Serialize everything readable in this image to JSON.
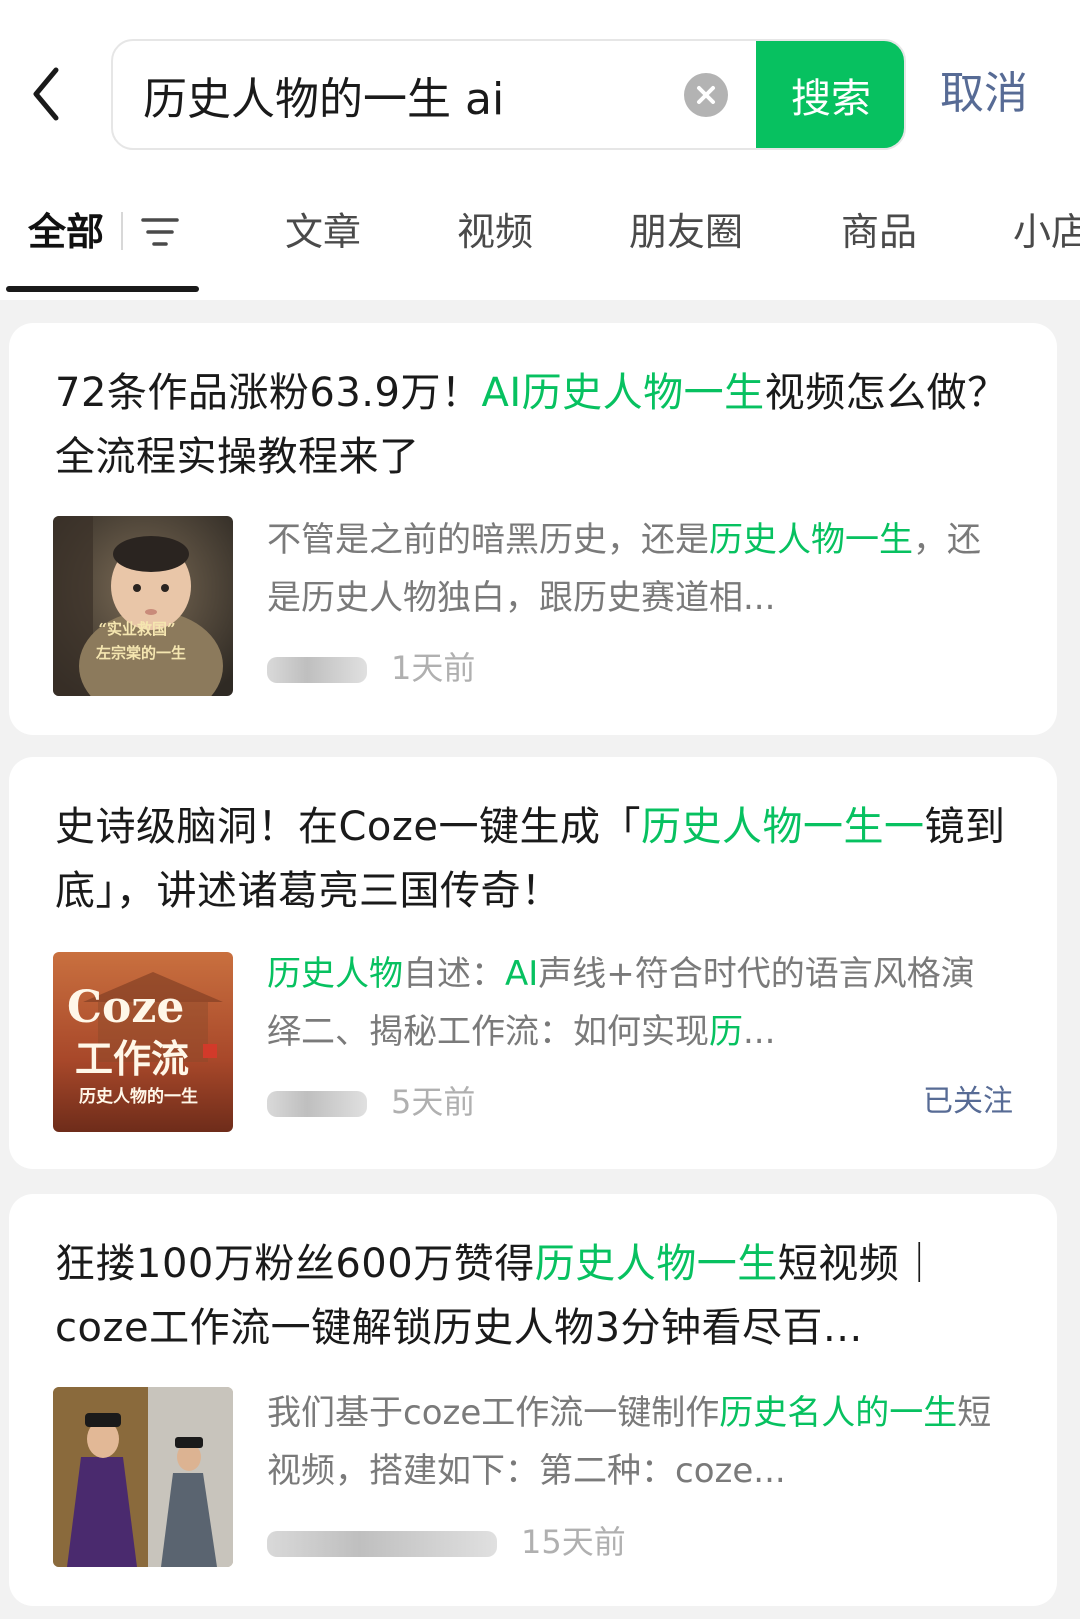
{
  "search": {
    "query": "历史人物的一生 ai",
    "search_button": "搜索",
    "cancel": "取消"
  },
  "tabs": [
    {
      "label": "全部"
    },
    {
      "label": "文章"
    },
    {
      "label": "视频"
    },
    {
      "label": "朋友圈"
    },
    {
      "label": "商品"
    },
    {
      "label": "小店"
    }
  ],
  "results": [
    {
      "title_parts": [
        {
          "text": "72条作品涨粉63.9万！",
          "hl": false
        },
        {
          "text": "AI历史人物一生",
          "hl": true
        },
        {
          "text": "视频怎么做？全流程实操教程来了",
          "hl": false
        }
      ],
      "desc_parts": [
        {
          "text": "不管是之前的暗黑历史，还是",
          "hl": false
        },
        {
          "text": "历史人物一生",
          "hl": true
        },
        {
          "text": "，还是历史人物独白，跟历史赛道相...",
          "hl": false
        }
      ],
      "thumb_caption_1": "“实业救国”",
      "thumb_caption_2": "左宗棠的一生",
      "time": "1天前",
      "followed": ""
    },
    {
      "title_parts": [
        {
          "text": "史诗级脑洞！在Coze一键生成「",
          "hl": false
        },
        {
          "text": "历史人物一生一",
          "hl": true
        },
        {
          "text": "镜到底」，讲述诸葛亮三国传奇！",
          "hl": false
        }
      ],
      "desc_parts": [
        {
          "text": "历史人物",
          "hl": true
        },
        {
          "text": "自述：",
          "hl": false
        },
        {
          "text": "AI",
          "hl": true
        },
        {
          "text": "声线+符合时代的语言风格演绎二、揭秘工作流：如何实现",
          "hl": false
        },
        {
          "text": "历",
          "hl": true
        },
        {
          "text": "...",
          "hl": false
        }
      ],
      "thumb_caption_1": "Coze",
      "thumb_caption_2": "工作流",
      "thumb_caption_3": "历史人物的一生",
      "time": "5天前",
      "followed": "已关注"
    },
    {
      "title_parts": [
        {
          "text": "狂搂100万粉丝600万赞得",
          "hl": false
        },
        {
          "text": "历史人物一生",
          "hl": true
        },
        {
          "text": "短视频｜coze工作流一键解锁历史人物3分钟看尽百...",
          "hl": false
        }
      ],
      "desc_parts": [
        {
          "text": "我们基于coze工作流一键制作",
          "hl": false
        },
        {
          "text": "历史名人的一生",
          "hl": true
        },
        {
          "text": "短视频，搭建如下：第二种：coze...",
          "hl": false
        }
      ],
      "time": "15天前",
      "followed": ""
    }
  ],
  "colors": {
    "accent_green": "#07c160",
    "link_blue": "#576b95",
    "page_bg": "#f2f2f2"
  },
  "icons": [
    "back-arrow-icon",
    "clear-icon",
    "filter-icon"
  ]
}
